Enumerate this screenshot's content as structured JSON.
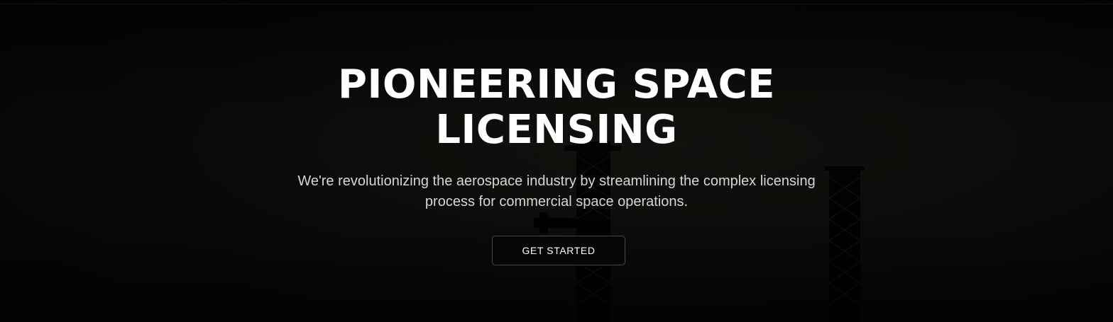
{
  "hero": {
    "title_line1": "PIONEERING SPACE",
    "title_line2": "LICENSING",
    "subtitle": "We're revolutionizing the aerospace industry by streamlining the complex licensing process for commercial space operations.",
    "cta_label": "GET STARTED"
  },
  "colors": {
    "background": "#050505",
    "text": "#ffffff",
    "subtitle_text": "#d6d6d6",
    "button_border": "#4a4a4a"
  },
  "icons": [
    "launch-tower-silhouette"
  ]
}
